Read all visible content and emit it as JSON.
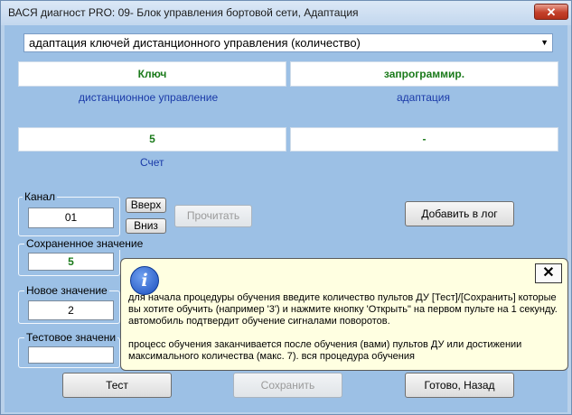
{
  "window": {
    "title": "ВАСЯ диагност PRO: 09- Блок управления бортовой сети, Адаптация",
    "close_glyph": "✕"
  },
  "selector": {
    "value": "адаптация ключей дистанционного управления (количество)",
    "arrow_glyph": "▼"
  },
  "fields": {
    "field1_value": "Ключ",
    "field1_label": "дистанционное управление",
    "field2_value": "запрограммир.",
    "field2_label": "адаптация",
    "field3_value": "5",
    "field3_label": "Счет",
    "field4_value": "-"
  },
  "channel": {
    "title": "Канал",
    "value": "01",
    "up_label": "Вверх",
    "down_label": "Вниз"
  },
  "buttons": {
    "read_label": "Прочитать",
    "add_log_label": "Добавить в лог",
    "test_label": "Тест",
    "save_label": "Сохранить",
    "done_label": "Готово, Назад"
  },
  "saved": {
    "title": "Сохраненное значение",
    "value": "5"
  },
  "new_value": {
    "title": "Новое значение",
    "value": "2"
  },
  "test_value": {
    "title": "Тестовое значени",
    "value": ""
  },
  "tooltip": {
    "icon_glyph": "i",
    "close_glyph": "✕",
    "paragraph1": "для начала процедуры обучения введите количество пультов ДУ [Тест]/[Сохранить] которые вы хотите обучить (например '3') и нажмите кнопку 'Открыть\" на первом пульте на 1 секунду. автомобиль подтвердит обучение сигналами поворотов.",
    "paragraph2": "процесс обучения заканчивается после обучения (вами) пультов ДУ или достижении максимального количества (макс. 7). вся процедура обучения"
  }
}
